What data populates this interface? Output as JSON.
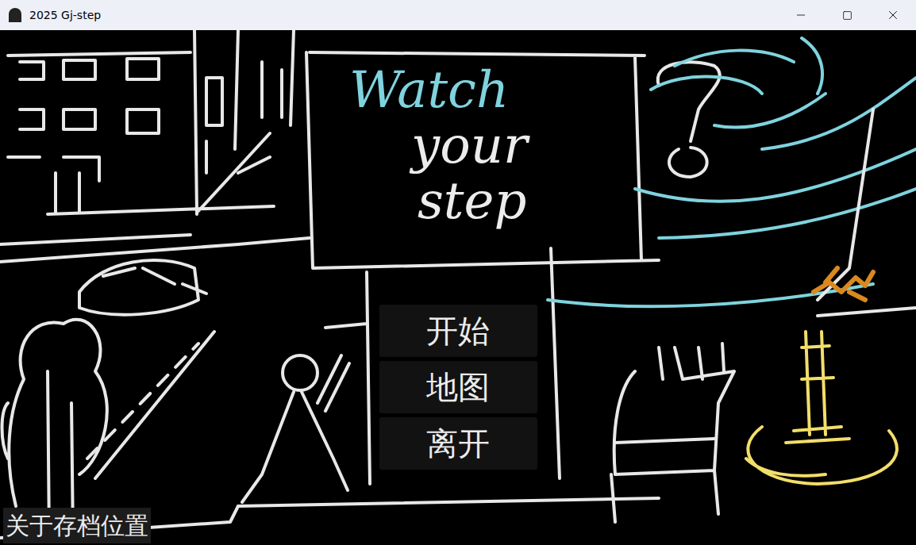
{
  "window": {
    "title": "2025 Gj-step"
  },
  "game_title": {
    "lines": [
      {
        "text": "Watch",
        "color": "#7fd3de"
      },
      {
        "text": "your",
        "color": "#ececec"
      },
      {
        "text": "step",
        "color": "#ececec"
      }
    ]
  },
  "menu": [
    {
      "label": "开始"
    },
    {
      "label": "地图"
    },
    {
      "label": "离开"
    }
  ],
  "footer_button": {
    "label": "关于存档位置"
  }
}
